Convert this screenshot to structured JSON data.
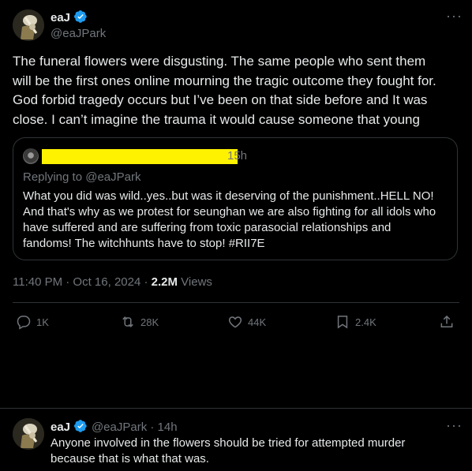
{
  "main_tweet": {
    "display_name": "eaJ",
    "handle": "@eaJPark",
    "text_lines": [
      "The funeral flowers were disgusting. The same people who sent them",
      "will be the first ones online mourning the tragic outcome they fought for.",
      "God forbid tragedy occurs but I’ve been on that side before and It was",
      "close. I can’t imagine the trauma it would cause someone that young"
    ],
    "timestamp": "11:40 PM · Oct 16, 2024 · ",
    "views_count": "2.2M",
    "views_label": " Views"
  },
  "quote": {
    "time": "15h",
    "replying_to": "Replying to @eaJPark",
    "text_lines": [
      "What you did was wild..yes..but was it deserving of the punishment..HELL NO!",
      "And that's why as we protest for seunghan we are also fighting for all idols who",
      "have suffered and are suffering from toxic parasocial relationships and",
      "fandoms! The witchhunts have to stop! #RII7E"
    ]
  },
  "actions": {
    "replies": "1K",
    "reposts": "28K",
    "likes": "44K",
    "bookmarks": "2.4K"
  },
  "reply_tweet": {
    "display_name": "eaJ",
    "handle_time": "@eaJPark · 14h",
    "text_lines": [
      "Anyone involved in the flowers should be tried for attempted murder",
      "because that is what that was."
    ]
  },
  "colors": {
    "background": "#000000",
    "text": "#e7e9ea",
    "muted": "#71767b",
    "verified": "#1d9bf0",
    "border": "#2f3336",
    "redaction": "#fff200"
  },
  "icons": [
    "verified-badge-icon",
    "more-icon",
    "reply-icon",
    "repost-icon",
    "like-icon",
    "bookmark-icon",
    "share-icon"
  ]
}
